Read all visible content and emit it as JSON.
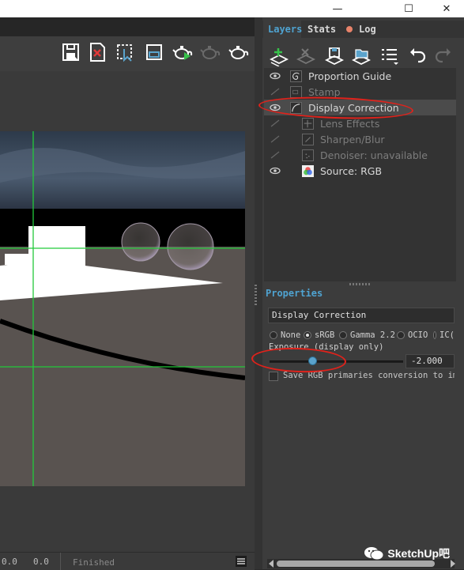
{
  "window": {
    "buttons": [
      "—",
      "☐",
      "✕"
    ]
  },
  "toolbar": {
    "icons": [
      "save-icon",
      "close-image-icon",
      "selection-icon",
      "frame-icon",
      "teapot-render-icon",
      "teapot-disabled-icon",
      "teapot-icon"
    ]
  },
  "status": {
    "val1": "0.0",
    "val2": "0.0",
    "text": "Finished"
  },
  "tabs": [
    {
      "label": "Layers",
      "color": "#4fa3d1"
    },
    {
      "label": "Stats",
      "color": "#d8d8d8"
    },
    {
      "label": "Log",
      "color": "#d8d8d8",
      "dot_color": "#e8836a"
    }
  ],
  "layers": [
    {
      "label": "Proportion Guide",
      "visible": true,
      "icon": "spiral-icon"
    },
    {
      "label": "Stamp",
      "visible": false,
      "icon": "stamp-icon"
    },
    {
      "label": "Display Correction",
      "visible": true,
      "icon": "curve-icon",
      "selected": true
    },
    {
      "label": "Lens Effects",
      "visible": false,
      "icon": "lens-icon"
    },
    {
      "label": "Sharpen/Blur",
      "visible": false,
      "icon": "sharpen-icon"
    },
    {
      "label": "Denoiser: unavailable",
      "visible": false,
      "icon": "denoise-icon"
    },
    {
      "label": "Source: RGB",
      "visible": true,
      "icon": "rgb-source-icon"
    }
  ],
  "properties": {
    "header": "Properties",
    "title": "Display Correction",
    "modes": [
      "None",
      "sRGB",
      "Gamma 2.2",
      "OCIO",
      "IC("
    ],
    "selected_mode": "sRGB",
    "exposure_label": "Exposure (display only)",
    "exposure_value": "-2.000",
    "exposure_fraction": 0.32,
    "checkbox_label": "Save RGB primaries conversion to ima"
  },
  "watermark": {
    "text": "SketchUp吧"
  },
  "colors": {
    "accent": "#4fa3d1",
    "annotation": "#e0221b",
    "guide_green": "#22c93a"
  }
}
